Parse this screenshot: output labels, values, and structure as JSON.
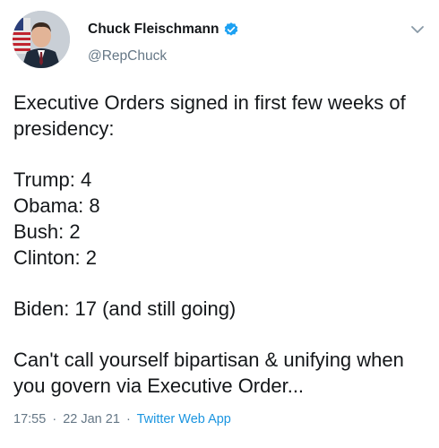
{
  "author": {
    "display_name": "Chuck Fleischmann",
    "handle": "@RepChuck",
    "verified": true,
    "verified_icon": "verified-badge-icon"
  },
  "tweet": {
    "lines": {
      "intro": "Executive Orders signed in first few weeks of presidency:",
      "trump": "Trump: 4",
      "obama": "Obama: 8",
      "bush": "Bush: 2",
      "clinton": "Clinton: 2",
      "biden": "Biden: 17 (and still going)",
      "closing": "Can't call yourself bipartisan & unifying when you govern via Executive Order..."
    }
  },
  "meta": {
    "time": "17:55",
    "separator": "·",
    "date": "22 Jan 21",
    "source": "Twitter Web App"
  },
  "colors": {
    "link": "#1b95e0",
    "secondary_text": "#657786",
    "verified": "#1da1f2"
  },
  "icons": {
    "menu": "chevron-down-icon"
  }
}
